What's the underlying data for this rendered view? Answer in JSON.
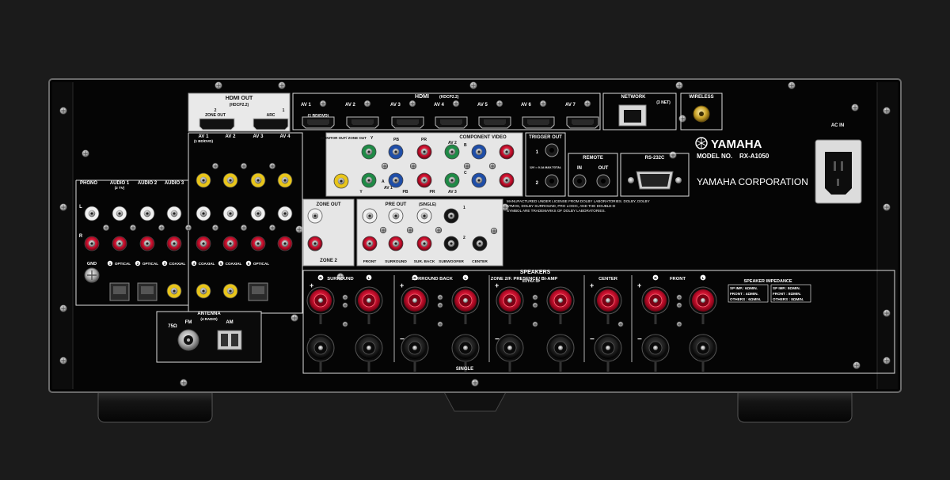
{
  "colors": {
    "background": "#1b1b1b",
    "chassis": "#050505",
    "panel_white": "#e9e9e9",
    "rca_red": "#c8102e",
    "rca_white": "#f0f0f0",
    "rca_yellow": "#e8c51a",
    "comp_green": "#1f8a46",
    "comp_blue": "#1f4ea8",
    "gold": "#c9a227"
  },
  "hdmi": {
    "title": "HDMI",
    "title_note": "(HDCP2.2)",
    "inputs": [
      "AV 1",
      "AV 2",
      "AV 3",
      "AV 4",
      "AV 5",
      "AV 6",
      "AV 7"
    ],
    "av1_note": "(1 BD/DVD)",
    "out_title": "HDMI OUT",
    "out_note": "(HDCP2.2)",
    "out_zone": "ZONE OUT",
    "out_arc": "ARC",
    "out_num_1": "1",
    "out_num_2": "2"
  },
  "network": {
    "label": "NETWORK",
    "note": "(3 NET)"
  },
  "wireless": {
    "label": "WIRELESS"
  },
  "ac_in": {
    "label": "AC IN"
  },
  "brand": {
    "logo": "YAMAHA",
    "model_label": "MODEL NO.",
    "model": "RX-A1050",
    "corporation": "YAMAHA CORPORATION"
  },
  "trigger": {
    "label": "TRIGGER OUT",
    "out_1": "1",
    "out_2": "2",
    "note": "12V ═ 0.1A MAX.TOTAL"
  },
  "remote": {
    "label": "REMOTE",
    "in": "IN",
    "out": "OUT"
  },
  "rs232": {
    "label": "RS-232C"
  },
  "component": {
    "title": "COMPONENT VIDEO",
    "monitor_out": "MONITOR OUT/ ZONE OUT",
    "y": "Y",
    "pb": "PB",
    "pr": "PR",
    "av1": "AV 1",
    "av2": "AV 2",
    "av3": "AV 3",
    "mark_a": "A",
    "mark_b": "B",
    "mark_c": "C"
  },
  "audio": {
    "phono": "PHONO",
    "audio1": "AUDIO 1",
    "audio1_note": "(2 TV)",
    "audio2": "AUDIO 2",
    "audio3": "AUDIO 3",
    "av1": "AV 1",
    "av1_note": "(1 BD/DVD)",
    "av2": "AV 2",
    "av3": "AV 3",
    "av4": "AV 4",
    "left": "L",
    "right": "R",
    "gnd": "GND",
    "dig": [
      {
        "num": "1",
        "type": "OPTICAL"
      },
      {
        "num": "2",
        "type": "OPTICAL"
      },
      {
        "num": "3",
        "type": "COAXIAL"
      },
      {
        "num": "4",
        "type": "COAXIAL"
      },
      {
        "num": "5",
        "type": "COAXIAL"
      },
      {
        "num": "6",
        "type": "OPTICAL"
      }
    ]
  },
  "zone_out": {
    "label": "ZONE OUT",
    "zone2": "ZONE 2"
  },
  "pre_out": {
    "label": "PRE OUT",
    "single": "(SINGLE)",
    "channels": [
      "FRONT",
      "SURROUND",
      "SUR. BACK",
      "SUBWOOFER",
      "CENTER"
    ],
    "num_1": "1",
    "num_2": "2"
  },
  "dolby_notice": "MANUFACTURED UNDER LICENSE FROM DOLBY LABORATORIES. DOLBY, DOLBY ATMOS, DOLBY SURROUND, PRO LOGIC, AND THE DOUBLE-D SYMBOL ARE TRADEMARKS OF DOLBY LABORATORIES.",
  "antenna": {
    "label": "ANTENNA",
    "note": "(4 RADIO)",
    "fm": "FM",
    "ohm": "75Ω",
    "am": "AM"
  },
  "speakers": {
    "title": "SPEAKERS",
    "groups": [
      "SURROUND",
      "SURROUND BACK",
      "ZONE 2/F. PRESENCE/ BI-AMP",
      "CENTER",
      "FRONT"
    ],
    "extra_sp": "EXTRA SP",
    "single": "SINGLE",
    "plus": "+",
    "minus": "−",
    "right": "R",
    "left": "L",
    "impedance": {
      "title": "SPEAKER IMPEDANCE",
      "col1_head": "SP IMP.: 6ΩMIN.",
      "col1_front": "FRONT : 4ΩMIN.",
      "col1_others": "OTHERS : 6ΩMIN.",
      "col2_head": "SP IMP.: 8ΩMIN.",
      "col2_front": "FRONT : 8ΩMIN.",
      "col2_others": "OTHERS : 8ΩMIN."
    }
  }
}
